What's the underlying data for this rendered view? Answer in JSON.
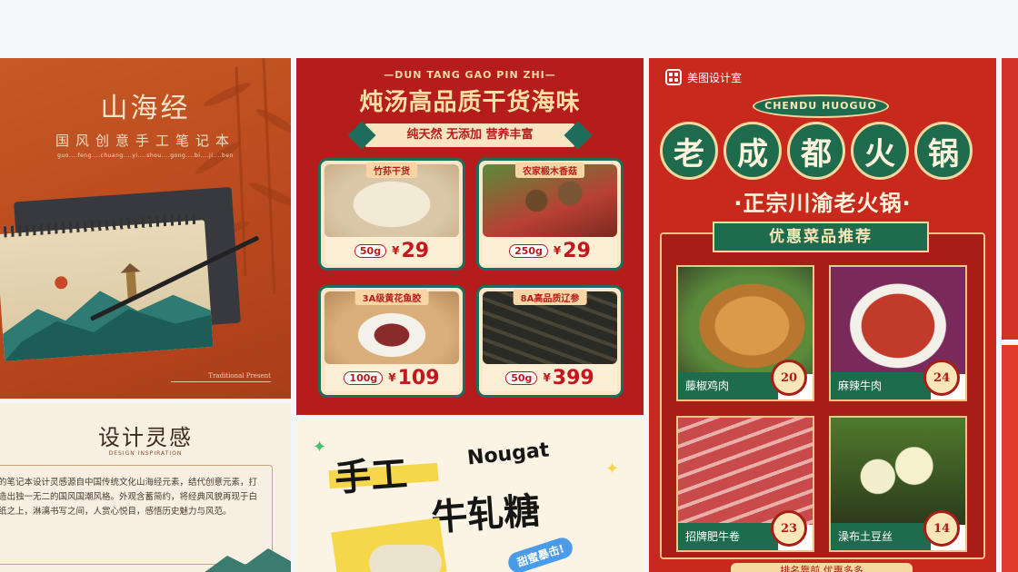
{
  "colors": {
    "page_bg": "#f4f5f8",
    "notebook_bg": "#c65a26",
    "seafood_bg": "#b51d1c",
    "hotpot_bg": "#c8291d",
    "green": "#1f6b4e",
    "nougat_bg": "#fbf4e4"
  },
  "cards": {
    "notebook": {
      "title": "山海经",
      "subtitle": "国风创意手工笔记本",
      "pinyin": "guo....feng....chuang....yi....shou....gong....bi....ji....ben",
      "footnote": "Traditional Present"
    },
    "inspiration": {
      "title": "设计灵感",
      "subtitle": "DESIGN INSPIRATION",
      "body": "的笔记本设计灵感源自中国传统文化山海经元素，结代创意元素，打造出独一无二的国风国潮风格。外观含蓄简约，将经典风貌再现于白纸之上，淋漓书写之间，人赏心悦目，感悟历史魅力与风范。"
    },
    "seafood": {
      "eng_title": "—DUN TANG GAO PIN ZHI—",
      "title": "炖汤高品质干货海味",
      "ribbon": "纯天然 无添加 营养丰富",
      "products": [
        {
          "name": "竹荪干货",
          "qty": "50g",
          "currency": "¥",
          "price": "29"
        },
        {
          "name": "农家椴木香菇",
          "qty": "250g",
          "currency": "¥",
          "price": "29"
        },
        {
          "name": "3A级黄花鱼胶",
          "qty": "100g",
          "currency": "¥",
          "price": "109"
        },
        {
          "name": "8A高品质辽参",
          "qty": "50g",
          "currency": "¥",
          "price": "399"
        }
      ]
    },
    "nougat": {
      "title_line1": "手工",
      "english": "Nougat",
      "title_line2": "牛轧糖",
      "sticker": "甜蜜暴击!"
    },
    "hotpot": {
      "brand": "美图设计室",
      "eng_banner": "CHENDU HUOGUO",
      "big_chars": [
        "老",
        "成",
        "都",
        "火",
        "锅"
      ],
      "slogan": "·正宗川渝老火锅·",
      "recommend": "优惠菜品推荐",
      "dishes": [
        {
          "name": "藤椒鸡肉",
          "price": "20"
        },
        {
          "name": "麻辣牛肉",
          "price": "24"
        },
        {
          "name": "招牌肥牛卷",
          "price": "23"
        },
        {
          "name": "澡布土豆丝",
          "price": "14"
        }
      ],
      "footer": "排名靠前 优惠多多"
    }
  }
}
